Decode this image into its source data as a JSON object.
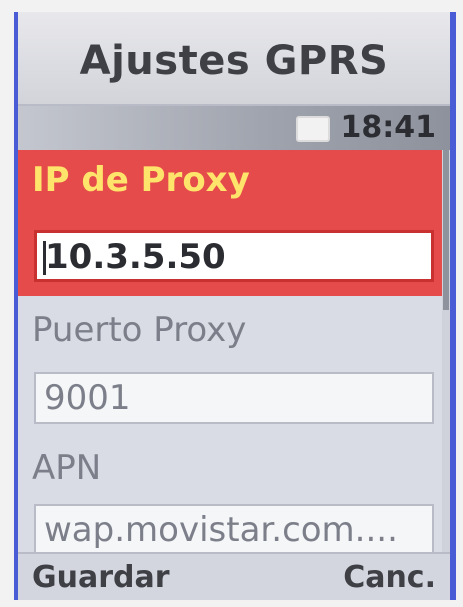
{
  "header": {
    "title": "Ajustes GPRS"
  },
  "status": {
    "time": "18:41",
    "icons": [
      "battery-icon"
    ]
  },
  "form": {
    "fields": [
      {
        "label": "IP de Proxy",
        "value": "10.3.5.50"
      },
      {
        "label": "Puerto Proxy",
        "value": "9001"
      },
      {
        "label": "APN",
        "value": "wap.movistar.com...."
      }
    ]
  },
  "softkeys": {
    "left": "Guardar",
    "right": "Canc."
  },
  "colors": {
    "accent": "#e54b4b",
    "selected_label": "#ffe46b",
    "frame": "#4a5bd6"
  }
}
